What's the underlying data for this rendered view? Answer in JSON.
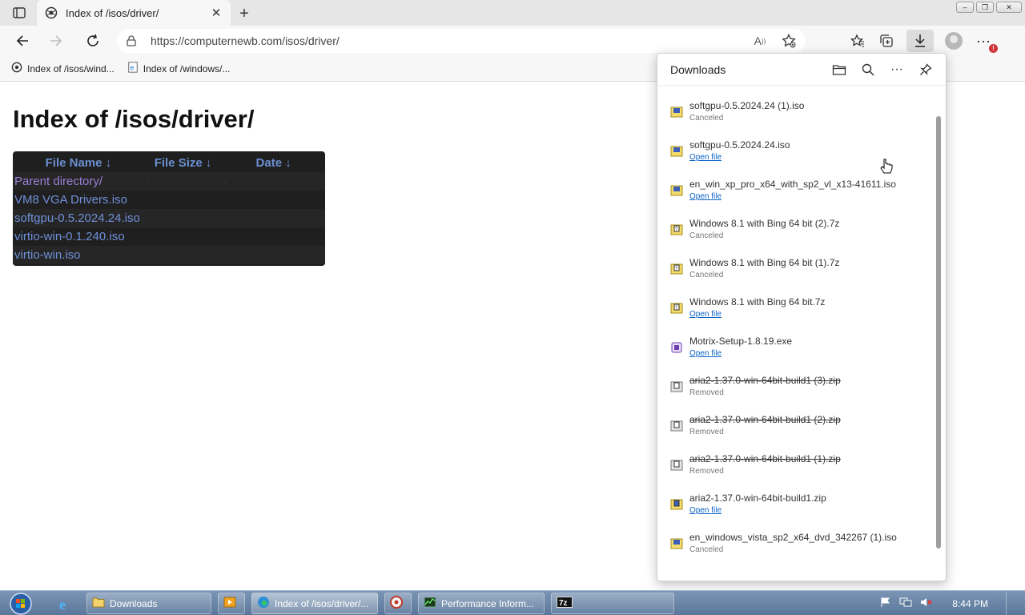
{
  "browser": {
    "tab": {
      "title": "Index of /isos/driver/"
    },
    "url": "https://computernewb.com/isos/driver/",
    "favorites": [
      {
        "label": "Index of /isos/wind..."
      },
      {
        "label": "Index of /windows/..."
      }
    ]
  },
  "page": {
    "title": "Index of /isos/driver/",
    "columns": [
      "File Name  ↓",
      "File Size  ↓",
      "Date  ↓"
    ],
    "rows": [
      {
        "name": "Parent directory/",
        "size": "-",
        "date": "-"
      },
      {
        "name": "VM8 VGA Drivers.iso",
        "size": "",
        "date": ""
      },
      {
        "name": "softgpu-0.5.2024.24.iso",
        "size": "",
        "date": ""
      },
      {
        "name": "virtio-win-0.1.240.iso",
        "size": "",
        "date": ""
      },
      {
        "name": "virtio-win.iso",
        "size": "",
        "date": ""
      }
    ]
  },
  "downloads": {
    "title": "Downloads",
    "items": [
      {
        "name": "softgpu-0.5.2024.24 (1).iso",
        "status": "Canceled",
        "icon": "disc-image-icon"
      },
      {
        "name": "softgpu-0.5.2024.24.iso",
        "status": "Open file",
        "icon": "disc-image-icon"
      },
      {
        "name": "en_win_xp_pro_x64_with_sp2_vl_x13-41611.iso",
        "status": "Open file",
        "icon": "disc-image-icon"
      },
      {
        "name": "Windows 8.1 with Bing 64 bit (2).7z",
        "status": "Canceled",
        "icon": "archive-icon"
      },
      {
        "name": "Windows 8.1 with Bing 64 bit (1).7z",
        "status": "Canceled",
        "icon": "archive-icon"
      },
      {
        "name": "Windows 8.1 with Bing 64 bit.7z",
        "status": "Open file",
        "icon": "archive-icon"
      },
      {
        "name": "Motrix-Setup-1.8.19.exe",
        "status": "Open file",
        "icon": "installer-icon"
      },
      {
        "name": "aria2-1.37.0-win-64bit-build1 (3).zip",
        "status": "Removed",
        "icon": "zip-icon"
      },
      {
        "name": "aria2-1.37.0-win-64bit-build1 (2).zip",
        "status": "Removed",
        "icon": "zip-icon"
      },
      {
        "name": "aria2-1.37.0-win-64bit-build1 (1).zip",
        "status": "Removed",
        "icon": "zip-icon"
      },
      {
        "name": "aria2-1.37.0-win-64bit-build1.zip",
        "status": "Open file",
        "icon": "zip-icon"
      },
      {
        "name": "en_windows_vista_sp2_x64_dvd_342267 (1).iso",
        "status": "Canceled",
        "icon": "disc-image-icon"
      }
    ]
  },
  "taskbar": {
    "buttons": [
      {
        "label": "Downloads"
      },
      {
        "label": ""
      },
      {
        "label": "Index of /isos/driver/..."
      },
      {
        "label": ""
      },
      {
        "label": "Performance Inform..."
      },
      {
        "label": ""
      }
    ],
    "clock": "8:44 PM"
  }
}
